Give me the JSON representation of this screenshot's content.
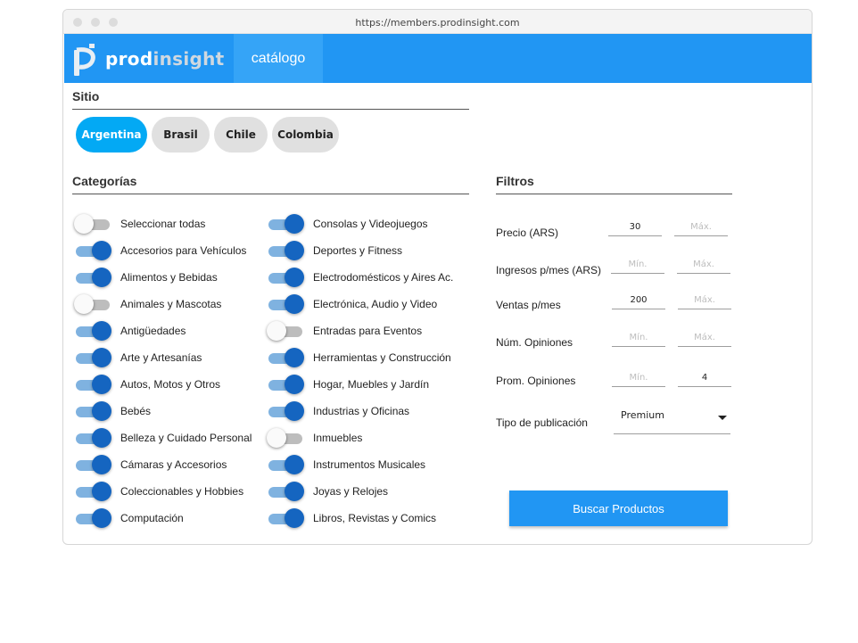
{
  "browser": {
    "url": "https://members.prodinsight.com"
  },
  "appbar": {
    "logo": {
      "part1": "prod",
      "part2": "insight",
      "accent": "#2196f3"
    },
    "nav_tab": "catálogo"
  },
  "sitio": {
    "title": "Sitio",
    "options": [
      {
        "label": "Argentina",
        "selected": true
      },
      {
        "label": "Brasil",
        "selected": false
      },
      {
        "label": "Chile",
        "selected": false
      },
      {
        "label": "Colombia",
        "selected": false
      }
    ]
  },
  "categorias": {
    "title": "Categorías",
    "left": [
      {
        "label": "Seleccionar todas",
        "on": false
      },
      {
        "label": "Accesorios para Vehículos",
        "on": true
      },
      {
        "label": "Alimentos y Bebidas",
        "on": true
      },
      {
        "label": "Animales y Mascotas",
        "on": false
      },
      {
        "label": "Antigüedades",
        "on": true
      },
      {
        "label": "Arte y Artesanías",
        "on": true
      },
      {
        "label": "Autos, Motos y Otros",
        "on": true
      },
      {
        "label": "Bebés",
        "on": true
      },
      {
        "label": "Belleza y Cuidado Personal",
        "on": true
      },
      {
        "label": "Cámaras y Accesorios",
        "on": true
      },
      {
        "label": "Coleccionables y Hobbies",
        "on": true
      },
      {
        "label": "Computación",
        "on": true
      }
    ],
    "right": [
      {
        "label": "Consolas y Videojuegos",
        "on": true
      },
      {
        "label": "Deportes y Fitness",
        "on": true
      },
      {
        "label": "Electrodomésticos y Aires Ac.",
        "on": true
      },
      {
        "label": "Electrónica, Audio y Video",
        "on": true
      },
      {
        "label": "Entradas para Eventos",
        "on": false
      },
      {
        "label": "Herramientas y Construcción",
        "on": true
      },
      {
        "label": "Hogar, Muebles y Jardín",
        "on": true
      },
      {
        "label": "Industrias y Oficinas",
        "on": true
      },
      {
        "label": "Inmuebles",
        "on": false
      },
      {
        "label": "Instrumentos Musicales",
        "on": true
      },
      {
        "label": "Joyas y Relojes",
        "on": true
      },
      {
        "label": "Libros, Revistas y Comics",
        "on": true
      }
    ]
  },
  "filtros": {
    "title": "Filtros",
    "precio": {
      "label": "Precio (ARS)",
      "min": "30",
      "max": "",
      "max_placeholder": "Máx."
    },
    "ingresos": {
      "label": "Ingresos p/mes (ARS)",
      "min": "",
      "max": "",
      "min_placeholder": "Mín.",
      "max_placeholder": "Máx."
    },
    "ventas": {
      "label": "Ventas p/mes",
      "min": "200",
      "max": "",
      "max_placeholder": "Máx."
    },
    "num_opiniones": {
      "label": "Núm. Opiniones",
      "min": "",
      "max": "",
      "min_placeholder": "Mín.",
      "max_placeholder": "Máx."
    },
    "prom_opiniones": {
      "label": "Prom. Opiniones",
      "min": "",
      "max": "4",
      "min_placeholder": "Mín."
    },
    "tipo": {
      "label": "Tipo de publicación",
      "value": "Premium"
    }
  },
  "search_button": "Buscar Productos"
}
